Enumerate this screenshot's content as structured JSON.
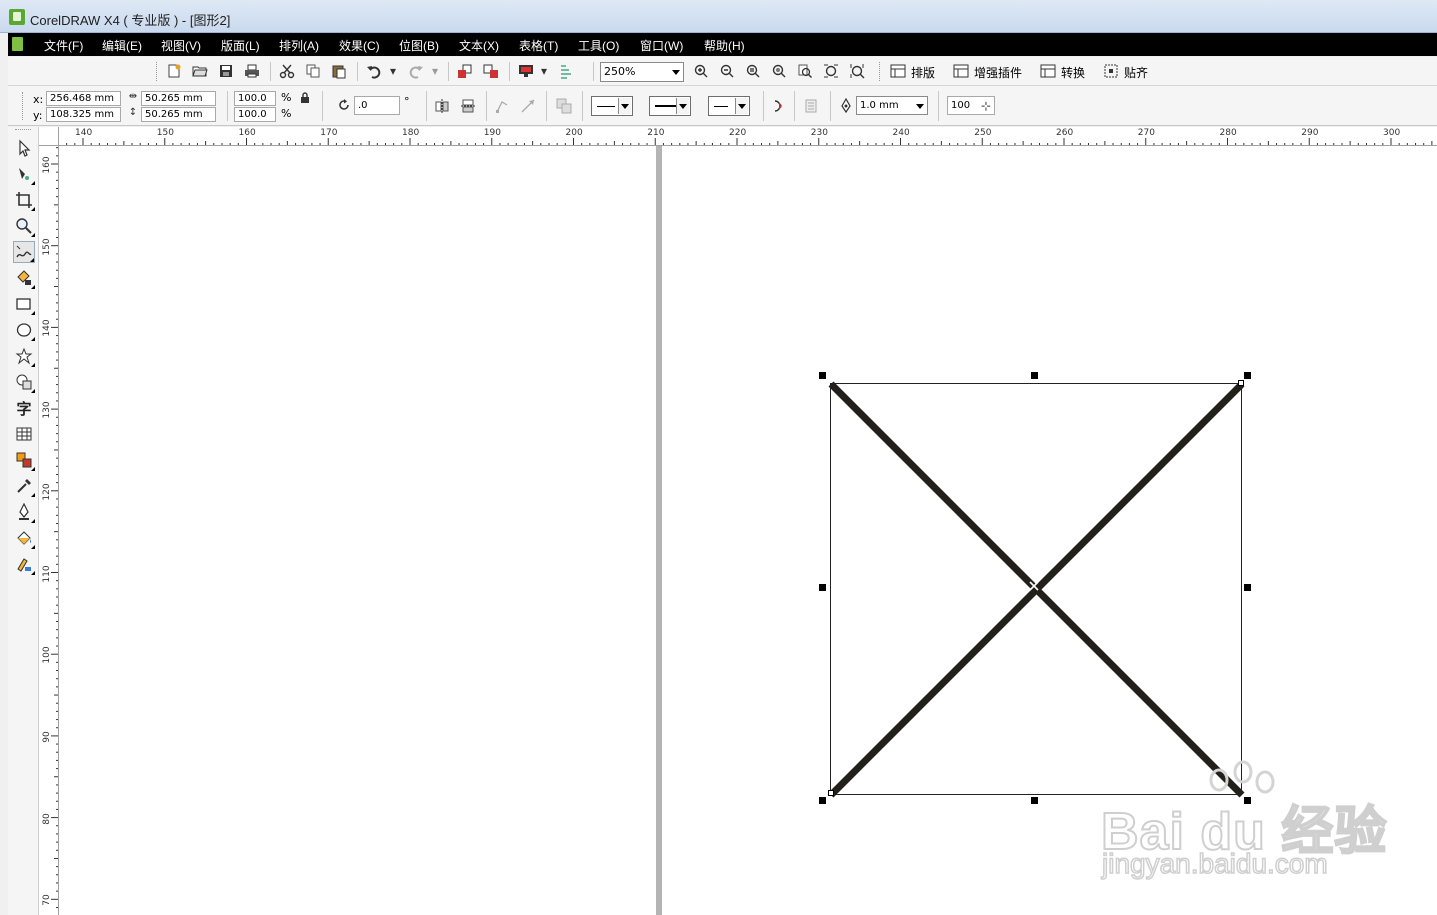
{
  "window": {
    "title": "CorelDRAW X4 ( 专业版 ) - [图形2]"
  },
  "menu": [
    "文件(F)",
    "编辑(E)",
    "视图(V)",
    "版面(L)",
    "排列(A)",
    "效果(C)",
    "位图(B)",
    "文本(X)",
    "表格(T)",
    "工具(O)",
    "窗口(W)",
    "帮助(H)"
  ],
  "standard_toolbar": {
    "zoom": "250%",
    "text_buttons": [
      "排版",
      "增强插件",
      "转换",
      "贴齐"
    ]
  },
  "property_bar": {
    "x_label": "x:",
    "y_label": "y:",
    "x_value": "256.468 mm",
    "y_value": "108.325 mm",
    "width_value": "50.265 mm",
    "height_value": "50.265 mm",
    "scale_x": "100.0",
    "scale_y": "100.0",
    "percent": "%",
    "rotation": ".0",
    "degree": "°",
    "outline_width": "1.0 mm",
    "curve_smoothness": "100"
  },
  "rulers": {
    "horizontal": [
      "140",
      "150",
      "160",
      "170",
      "180",
      "190",
      "200",
      "210",
      "220",
      "230",
      "240",
      "250",
      "260",
      "270",
      "280",
      "290",
      "300"
    ],
    "vertical": [
      "160",
      "150",
      "140",
      "130",
      "120",
      "110",
      "100",
      "90",
      "80",
      "70"
    ]
  },
  "drawing": {
    "stroke_color": "#231f1b",
    "shape": "x-cross-in-square",
    "state": "selected"
  },
  "watermark": {
    "brand": "Bai du 经验",
    "url": "jingyan.baidu.com"
  }
}
